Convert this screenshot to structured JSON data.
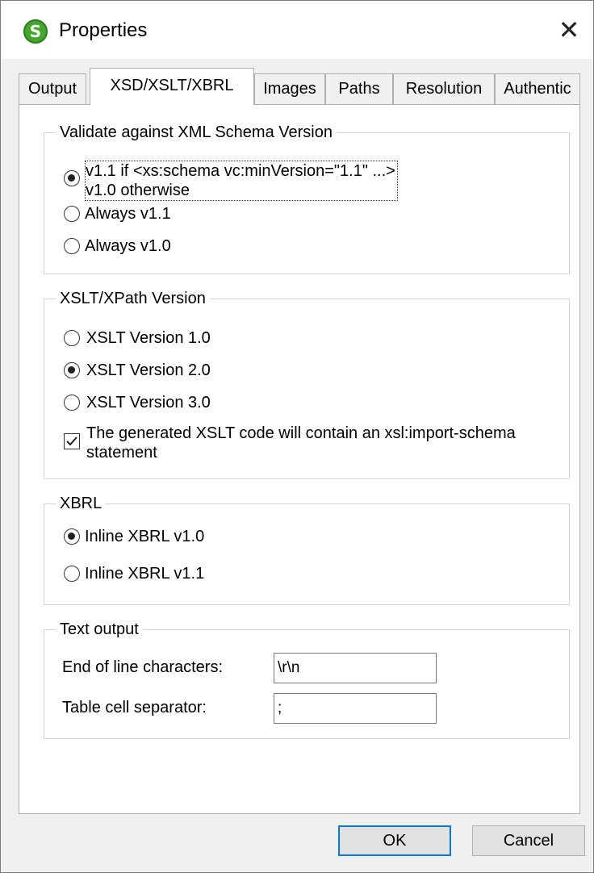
{
  "window": {
    "title": "Properties",
    "close_glyph": "✕",
    "app_icon_letter": "S"
  },
  "tabs": [
    {
      "label": "Output",
      "active": false
    },
    {
      "label": "XSD/XSLT/XBRL",
      "active": true
    },
    {
      "label": "Images",
      "active": false
    },
    {
      "label": "Paths",
      "active": false
    },
    {
      "label": "Resolution",
      "active": false
    },
    {
      "label": "Authentic",
      "active": false
    }
  ],
  "schema_group": {
    "legend": "Validate against XML Schema Version",
    "options": [
      {
        "line1": "v1.1 if <xs:schema vc:minVersion=\"1.1\" ...>",
        "line2": "v1.0 otherwise",
        "checked": true
      },
      {
        "line1": "Always v1.1",
        "checked": false
      },
      {
        "line1": "Always v1.0",
        "checked": false
      }
    ]
  },
  "xslt_group": {
    "legend": "XSLT/XPath Version",
    "options": [
      {
        "label": "XSLT Version 1.0",
        "checked": false
      },
      {
        "label": "XSLT Version 2.0",
        "checked": true
      },
      {
        "label": "XSLT Version 3.0",
        "checked": false
      }
    ],
    "import_schema": {
      "line1": "The generated XSLT code will contain an xsl:import-schema",
      "line2": "statement",
      "checked": true
    }
  },
  "xbrl_group": {
    "legend": "XBRL",
    "options": [
      {
        "label": "Inline XBRL v1.0",
        "checked": true
      },
      {
        "label": "Inline XBRL v1.1",
        "checked": false
      }
    ]
  },
  "text_output_group": {
    "legend": "Text output",
    "eol_label": "End of line characters:",
    "eol_value": "\\r\\n",
    "sep_label": "Table cell separator:",
    "sep_value": ";"
  },
  "buttons": {
    "ok": "OK",
    "cancel": "Cancel"
  },
  "colors": {
    "accent": "#0078d7",
    "app_icon": "#44a52f"
  }
}
